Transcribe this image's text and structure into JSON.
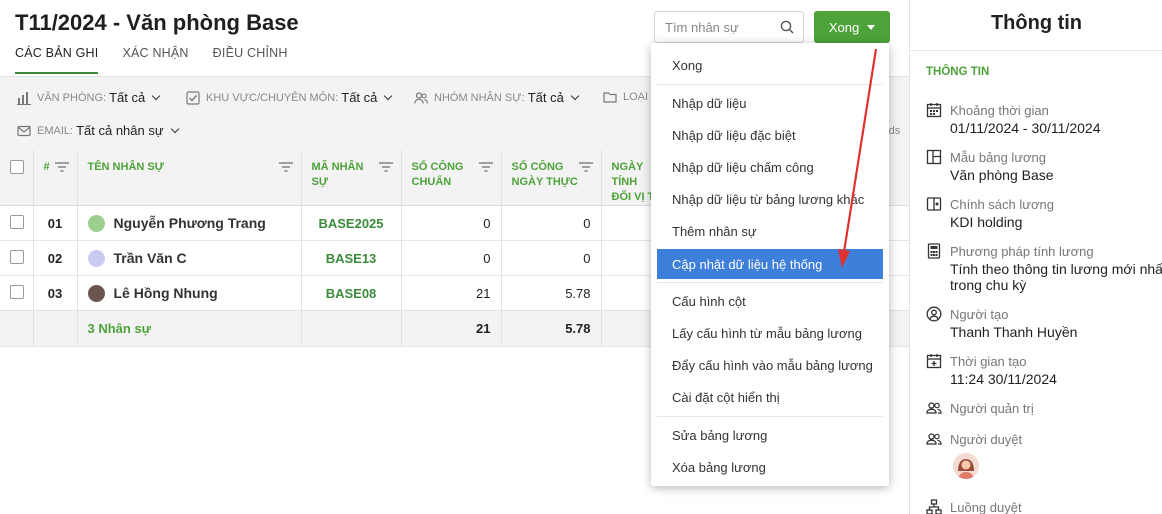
{
  "header": {
    "title": "T11/2024 - Văn phòng Base",
    "tabs": [
      "CÁC BẢN GHI",
      "XÁC NHẬN",
      "ĐIỀU CHỈNH"
    ],
    "search_placeholder": "Tìm nhân sự",
    "done_label": "Xong"
  },
  "filters": {
    "office_label": "VĂN PHÒNG:",
    "office_value": "Tất cả",
    "area_label": "KHU VỰC/CHUYÊN MÔN:",
    "area_value": "Tất cả",
    "group_label": "NHÓM NHÂN SỰ:",
    "group_value": "Tất cả",
    "type_label": "LOẠI",
    "email_label": "EMAIL:",
    "email_value": "Tất cả nhân sự",
    "hidden_text": "rds"
  },
  "table": {
    "columns": [
      "#",
      "TÊN NHÂN SỰ",
      "MÃ NHÂN SỰ",
      "SỐ CÔNG CHUẨN",
      "SỐ CÔNG NGÀY THỰC",
      "NGÀY TÍNH ĐỐI VỊ T"
    ],
    "rows": [
      {
        "no": "01",
        "name": "Nguyễn Phương Trang",
        "code": "BASE2025",
        "standard": "0",
        "actual": "0"
      },
      {
        "no": "02",
        "name": "Trần Văn C",
        "code": "BASE13",
        "standard": "0",
        "actual": "0"
      },
      {
        "no": "03",
        "name": "Lê Hồng Nhung",
        "code": "BASE08",
        "standard": "21",
        "actual": "5.78"
      }
    ],
    "summary": {
      "count": "3 Nhân sự",
      "standard": "21",
      "actual": "5.78"
    }
  },
  "dropdown": {
    "items": [
      "Xong",
      "Nhập dữ liệu",
      "Nhập dữ liệu đặc biệt",
      "Nhập dữ liệu chấm công",
      "Nhập dữ liệu từ bảng lương khác",
      "Thêm nhân sự",
      "Cập nhật dữ liệu hệ thống",
      "Cấu hình cột",
      "Lấy cấu hình từ mẫu bảng lương",
      "Đẩy cấu hình vào mẫu bảng lương",
      "Cài đặt cột hiển thị",
      "Sửa bảng lương",
      "Xóa bảng lương"
    ],
    "highlighted": "Cập nhật dữ liệu hệ thống"
  },
  "panel": {
    "title": "Thông tin",
    "section": "THÔNG TIN",
    "period_label": "Khoảng thời gian",
    "period_value": "01/11/2024 - 30/11/2024",
    "template_label": "Mẫu bảng lương",
    "template_value": "Văn phòng Base",
    "policy_label": "Chính sách lương",
    "policy_value": "KDI holding",
    "method_label": "Phương pháp tính lương",
    "method_value_1": "Tính theo thông tin lương mới nhất",
    "method_value_2": "trong chu kỳ",
    "creator_label": "Người tạo",
    "creator_value": "Thanh Thanh Huyền",
    "created_label": "Thời gian tạo",
    "created_value": "11:24 30/11/2024",
    "admin_label": "Người quản trị",
    "approver_label": "Người duyệt",
    "flow_label": "Luồng duyệt"
  },
  "colors": {
    "accent": "#4ea23a",
    "highlight": "#3f7fdc",
    "annotation_arrow": "#e03131"
  }
}
